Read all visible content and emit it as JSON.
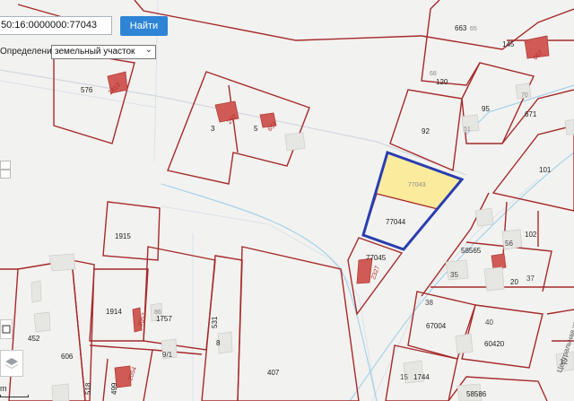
{
  "search": {
    "value": "50:16:0000000:77043",
    "button_label": "Найти"
  },
  "definition": {
    "label": "Определение:",
    "selected": "земельный участок"
  },
  "selected_parcel": {
    "number": "77043",
    "highlight_color": "#fbeb9d",
    "outline_color": "#2a3db0"
  },
  "parcel_labels": {
    "p663": "663",
    "p65": "65",
    "p145": "145",
    "p68": "68",
    "p120": "120",
    "p92": "92",
    "p95": "95",
    "p51": "51",
    "p70": "70",
    "p671": "671",
    "p101": "101",
    "p576": "576",
    "p3": "3",
    "p5": "5",
    "p77043": "77043",
    "p77044": "77044",
    "p77045": "77045",
    "p1915": "1915",
    "p1914": "1914",
    "p1757": "1757",
    "p86": "86",
    "p452": "452",
    "p606": "606",
    "p91": "9/1",
    "p8": "8",
    "p531": "531",
    "p407": "407",
    "p518": "518",
    "p499": "499",
    "p58565": "58565",
    "p56": "56",
    "p102": "102",
    "p35": "35",
    "p20": "20",
    "p37": "37",
    "p38": "38",
    "p67004": "67004",
    "p40": "40",
    "p60420": "60420",
    "p15": "15",
    "p1744": "1744",
    "p58586": "58586",
    "p12": "12"
  },
  "building_labels": {
    "b657": "657",
    "b2413": "2413",
    "b297": "297",
    "b657b": "657",
    "b2327": "2327",
    "b2057": "2057",
    "b2054": "2054"
  },
  "street_label": "Центральная ул",
  "scale": {
    "label": "m"
  },
  "colors": {
    "parcel_border": "#a52a2a",
    "building_red": "#d05a55",
    "button": "#2f84d6",
    "stream": "#9fd0ea"
  }
}
